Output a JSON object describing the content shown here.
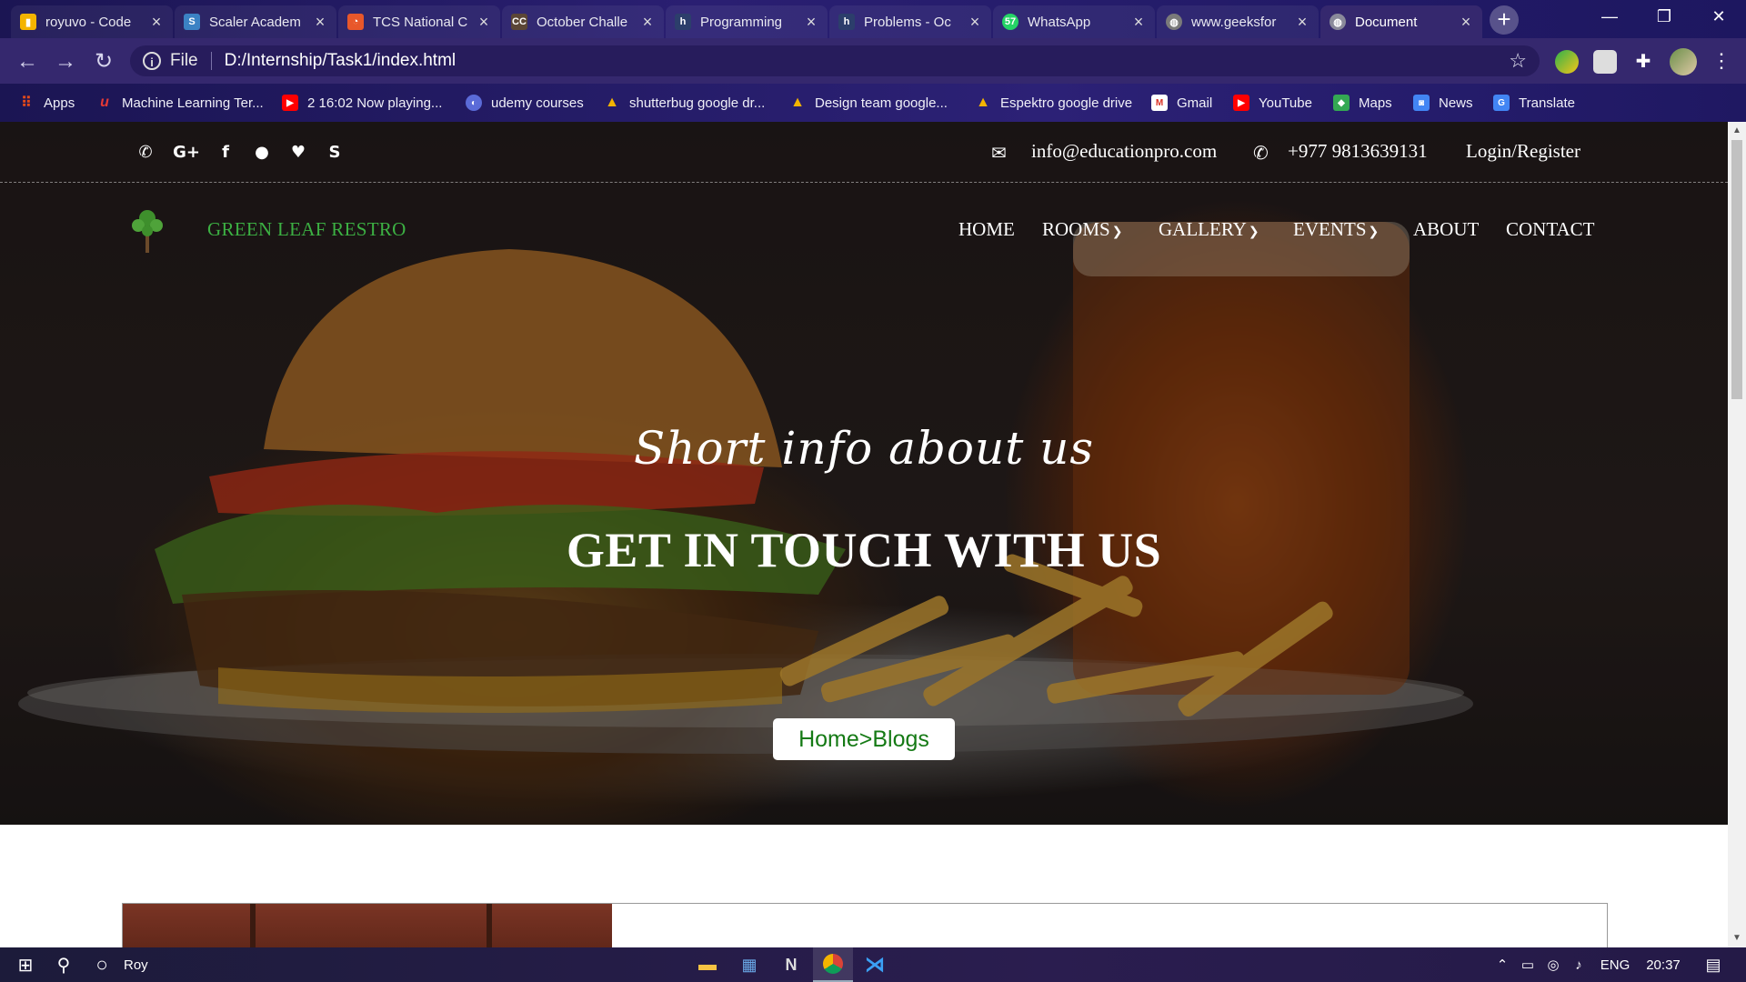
{
  "browser": {
    "tabs": [
      {
        "title": "royuvo - Code",
        "fav_color": "#f4b400",
        "glyph": "▮"
      },
      {
        "title": "Scaler Academ",
        "fav_color": "#3b82c4",
        "glyph": "S"
      },
      {
        "title": "TCS National C",
        "fav_color": "#e8572a",
        "glyph": "◔"
      },
      {
        "title": "October Challe",
        "fav_color": "#5b4636",
        "glyph": "CC"
      },
      {
        "title": "Programming",
        "fav_color": "#2c3e6b",
        "glyph": "h"
      },
      {
        "title": "Problems - Oc",
        "fav_color": "#2c3e6b",
        "glyph": "h"
      },
      {
        "title": "WhatsApp",
        "fav_color": "#25d366",
        "glyph": "57"
      },
      {
        "title": "www.geeksfor",
        "fav_color": "#7a7a7a",
        "glyph": "◍"
      },
      {
        "title": "Document",
        "fav_color": "#8a8a9a",
        "glyph": "◍"
      }
    ],
    "address": {
      "scheme_label": "File",
      "url": "D:/Internship/Task1/index.html"
    },
    "bookmarks": [
      {
        "label": "Apps",
        "color": "#e64a19",
        "glyph": "⠿"
      },
      {
        "label": "Machine Learning Ter...",
        "color": "#c62828",
        "glyph": "u"
      },
      {
        "label": "2 16:02 Now playing...",
        "color": "#ff0000",
        "glyph": "▶"
      },
      {
        "label": "udemy courses",
        "color": "#5b6bd8",
        "glyph": "◐"
      },
      {
        "label": "shutterbug google dr...",
        "color": "#f4b400",
        "glyph": "▲"
      },
      {
        "label": "Design team google...",
        "color": "#f4b400",
        "glyph": "▲"
      },
      {
        "label": "Espektro google drive",
        "color": "#f4b400",
        "glyph": "▲"
      },
      {
        "label": "Gmail",
        "color": "#d93025",
        "glyph": "M"
      },
      {
        "label": "YouTube",
        "color": "#ff0000",
        "glyph": "▶"
      },
      {
        "label": "Maps",
        "color": "#34a853",
        "glyph": "◆"
      },
      {
        "label": "News",
        "color": "#4285f4",
        "glyph": "◙"
      },
      {
        "label": "Translate",
        "color": "#4285f4",
        "glyph": "G"
      }
    ]
  },
  "site": {
    "top_bar": {
      "social_icons": [
        "phone-icon",
        "google-plus-icon",
        "facebook-icon",
        "chat-icon",
        "twitter-icon",
        "skype-icon"
      ],
      "email": "info@educationpro.com",
      "phone": "+977 9813639131",
      "login": "Login/Register"
    },
    "brand": {
      "name": "GREEN LEAF RESTRO",
      "color": "#3cb043"
    },
    "nav": {
      "home": "HOME",
      "rooms": "ROOMS",
      "gallery": "GALLERY",
      "events": "EVENTS",
      "about": "ABOUT",
      "contact": "CONTACT"
    },
    "hero": {
      "subtitle": "Short info about us",
      "title": "GET IN TOUCH WITH US",
      "breadcrumb": "Home>Blogs",
      "breadcrumb_color": "#157a15"
    }
  },
  "taskbar": {
    "search_text": "Roy",
    "language": "ENG",
    "time": "20:37"
  }
}
